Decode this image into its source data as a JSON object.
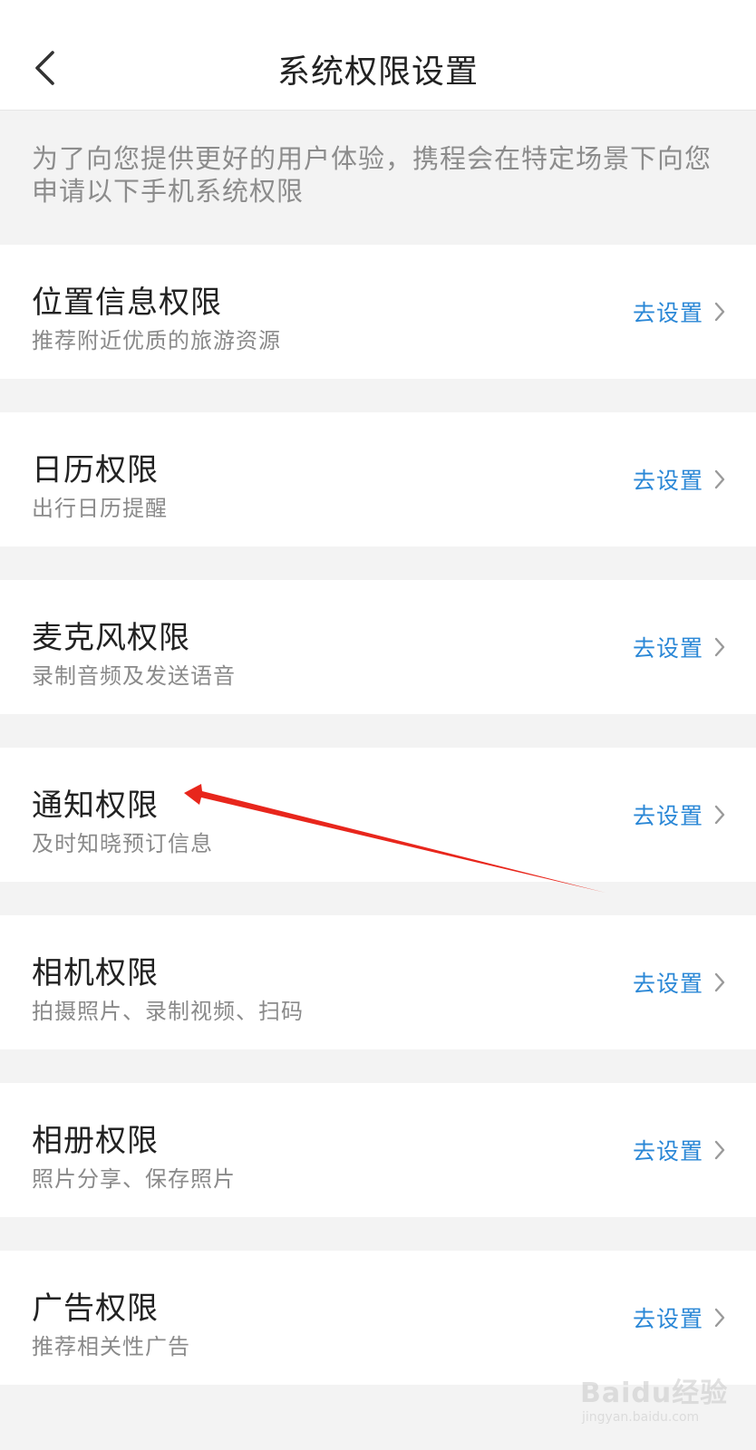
{
  "header": {
    "title": "系统权限设置"
  },
  "notice": "为了向您提供更好的用户体验，携程会在特定场景下向您申请以下手机系统权限",
  "action_label": "去设置",
  "permissions": [
    {
      "title": "位置信息权限",
      "subtitle": "推荐附近优质的旅游资源"
    },
    {
      "title": "日历权限",
      "subtitle": "出行日历提醒"
    },
    {
      "title": "麦克风权限",
      "subtitle": "录制音频及发送语音"
    },
    {
      "title": "通知权限",
      "subtitle": "及时知晓预订信息"
    },
    {
      "title": "相机权限",
      "subtitle": "拍摄照片、录制视频、扫码"
    },
    {
      "title": "相册权限",
      "subtitle": "照片分享、保存照片"
    },
    {
      "title": "广告权限",
      "subtitle": "推荐相关性广告"
    }
  ],
  "watermark": {
    "brand": "Baidu经验",
    "url": "jingyan.baidu.com"
  },
  "colors": {
    "accent": "#2a87d6",
    "annotation_arrow": "#e8261c",
    "background": "#f3f3f3"
  },
  "icons": {
    "back": "chevron-left-icon",
    "row_action": "chevron-right-icon"
  }
}
